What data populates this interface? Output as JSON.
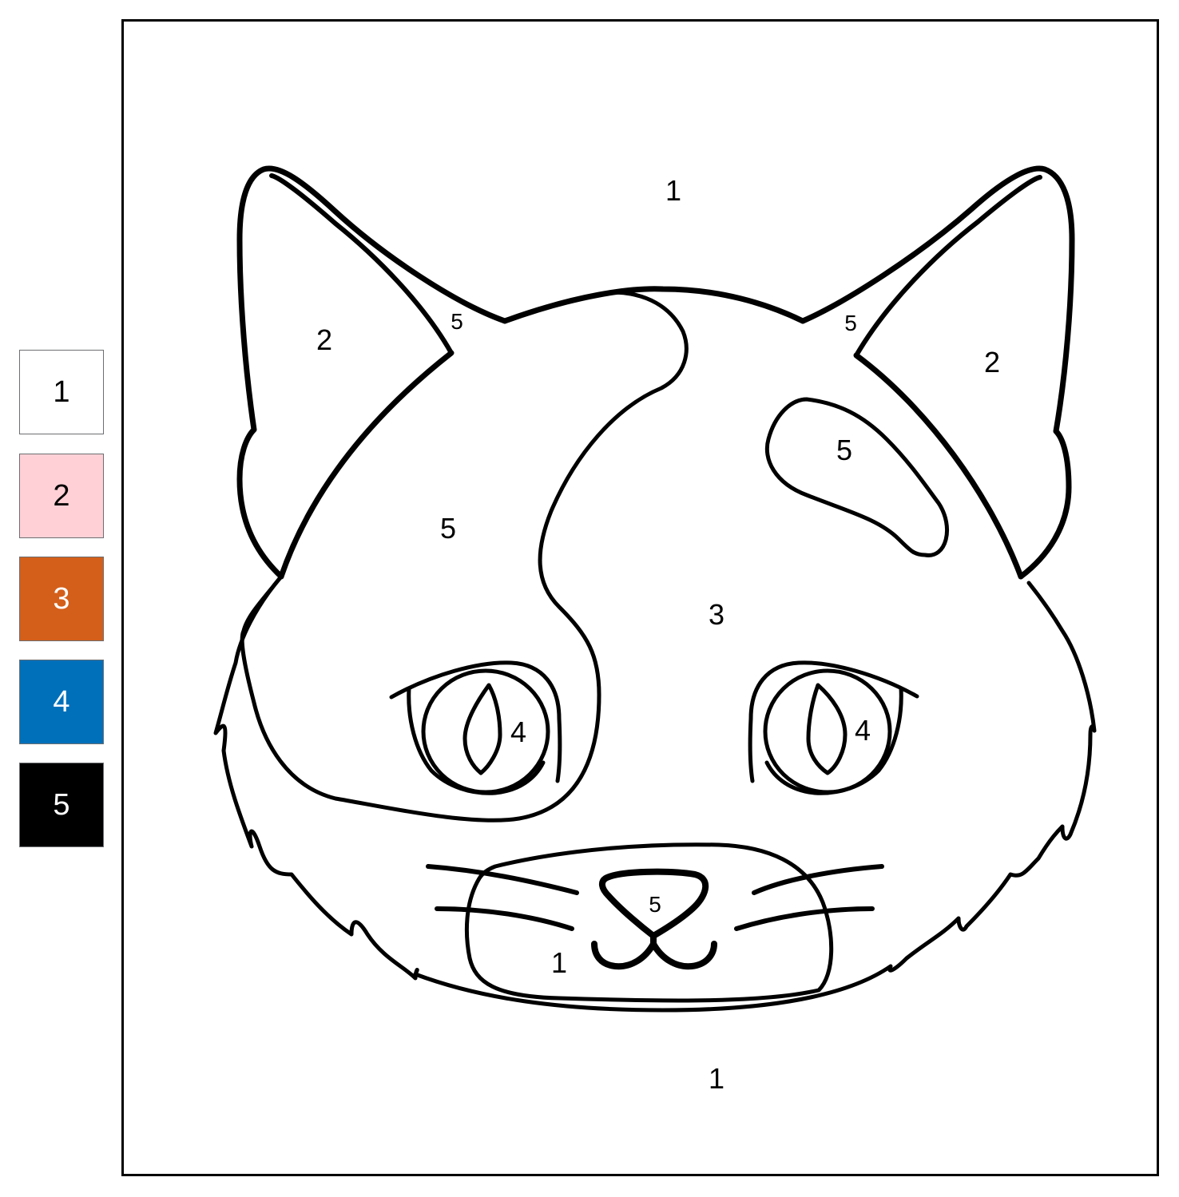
{
  "palette": [
    {
      "number": "1",
      "color": "#ffffff",
      "text_color": "#000000"
    },
    {
      "number": "2",
      "color": "#ffd1d6",
      "text_color": "#000000"
    },
    {
      "number": "3",
      "color": "#d45f1a",
      "text_color": "#ffffff"
    },
    {
      "number": "4",
      "color": "#0070bb",
      "text_color": "#ffffff"
    },
    {
      "number": "5",
      "color": "#000000",
      "text_color": "#ffffff"
    }
  ],
  "regions": {
    "background_top": "1",
    "background_bottom": "1",
    "left_ear_outer": "2",
    "right_ear_outer": "2",
    "left_ear_inner": "5",
    "right_ear_inner": "5",
    "left_patch": "5",
    "right_patch": "5",
    "face": "3",
    "left_eye": "4",
    "right_eye": "4",
    "nose": "5",
    "muzzle": "1"
  }
}
